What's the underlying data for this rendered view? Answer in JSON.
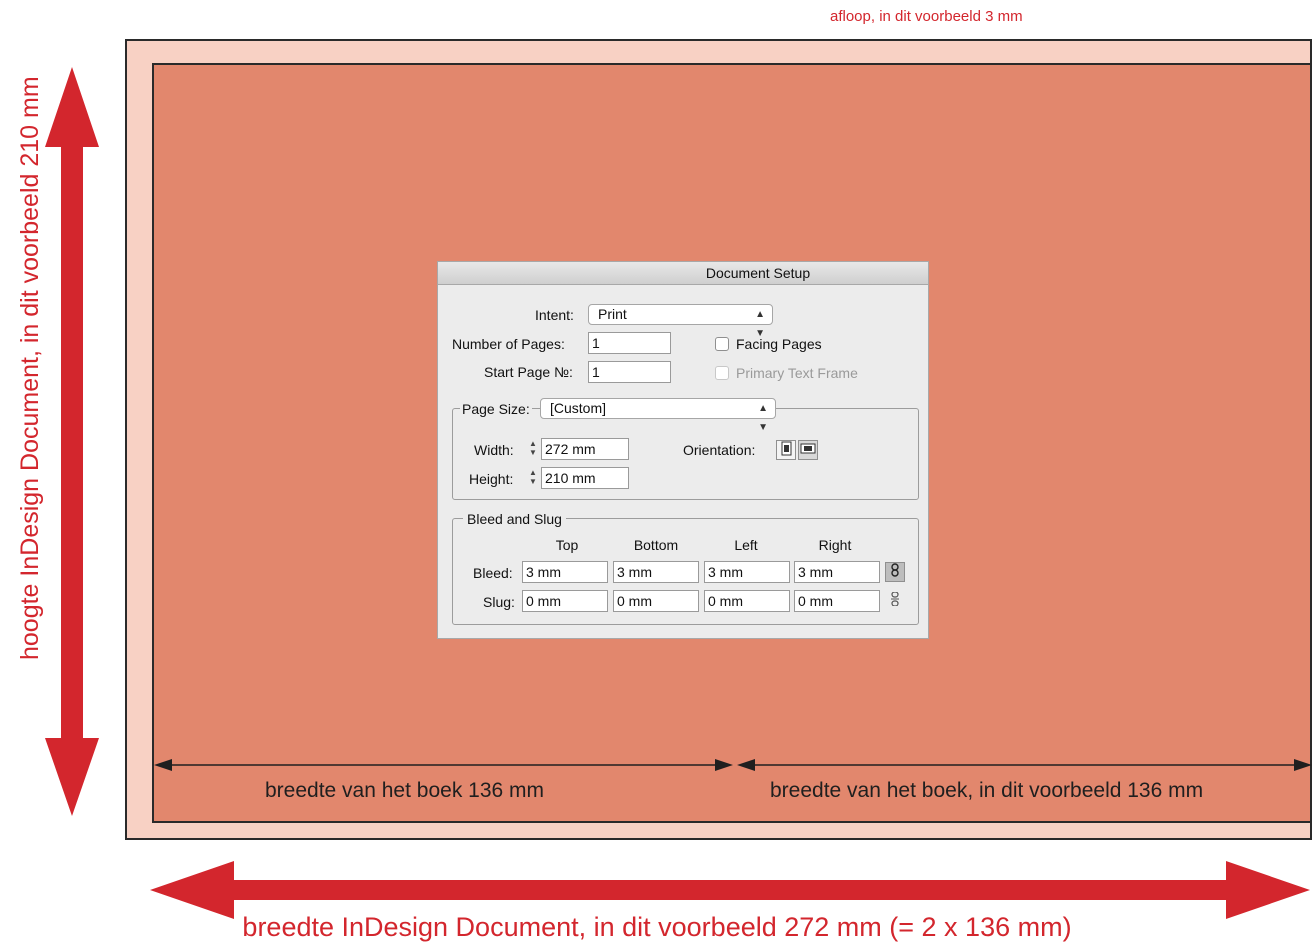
{
  "annotations": {
    "bleed_caption": "afloop, in dit voorbeeld 3 mm",
    "page_left_caption": "breedte van het boek 136 mm",
    "page_right_caption": "breedte van het boek, in dit voorbeeld 136 mm",
    "height_caption": "hoogte InDesign Document, in dit voorbeeld 210 mm",
    "width_caption": "breedte InDesign Document, in dit voorbeeld 272 mm (= 2 x 136 mm)"
  },
  "colors": {
    "arrow_red": "#d3262d",
    "trim_fill": "#e2876d",
    "bleed_fill": "#f8d1c4"
  },
  "dialog": {
    "title": "Document Setup",
    "intent_label": "Intent:",
    "intent_value": "Print",
    "pages_label": "Number of Pages:",
    "pages_value": "1",
    "start_label": "Start Page №:",
    "start_value": "1",
    "facing_pages_label": "Facing Pages",
    "primary_frame_label": "Primary Text Frame",
    "page_size_label": "Page Size:",
    "page_size_value": "[Custom]",
    "width_label": "Width:",
    "width_value": "272 mm",
    "height_label": "Height:",
    "height_value": "210 mm",
    "orientation_label": "Orientation:",
    "bleed_slug_label": "Bleed and Slug",
    "columns": [
      "Top",
      "Bottom",
      "Left",
      "Right"
    ],
    "bleed_label": "Bleed:",
    "bleed_values": [
      "3 mm",
      "3 mm",
      "3 mm",
      "3 mm"
    ],
    "slug_label": "Slug:",
    "slug_values": [
      "0 mm",
      "0 mm",
      "0 mm",
      "0 mm"
    ],
    "icons": {
      "portrait": "portrait-orientation-icon",
      "landscape": "landscape-orientation-icon",
      "link": "chain-link-icon",
      "unlink": "broken-chain-icon"
    }
  }
}
